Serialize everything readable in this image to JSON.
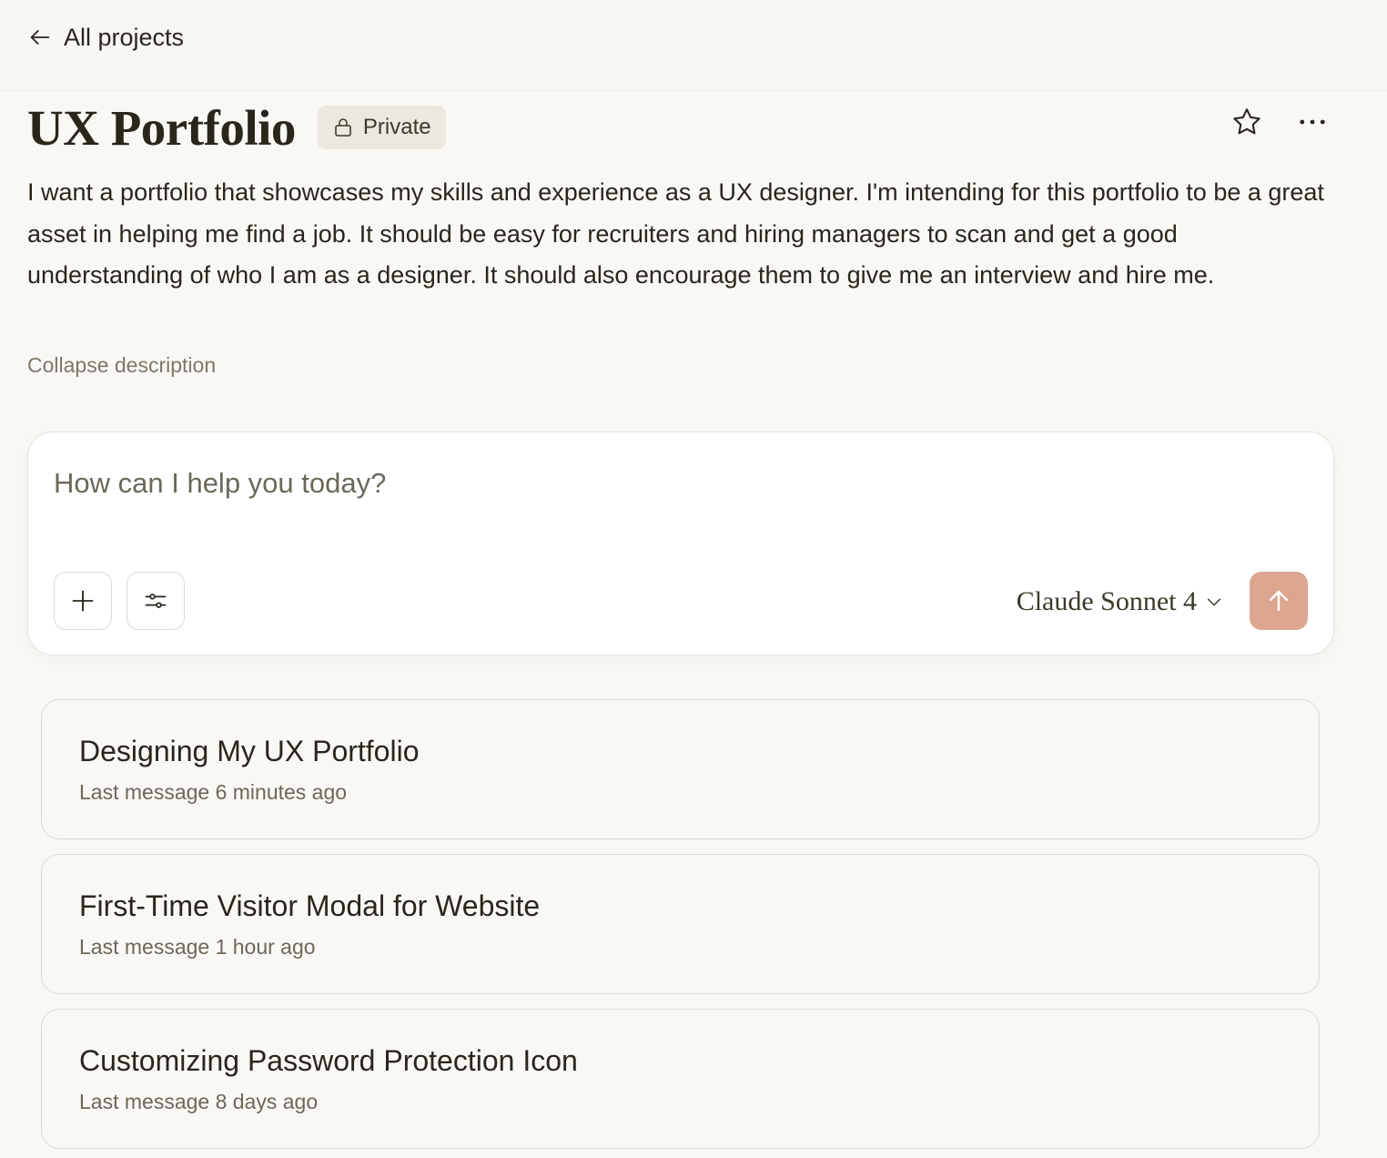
{
  "nav": {
    "back_label": "All projects",
    "back_icon": "arrow-left-icon"
  },
  "project": {
    "title": "UX Portfolio",
    "visibility": "Private",
    "visibility_icon": "lock-icon",
    "description": "I want a portfolio that showcases my skills and experience as a UX designer. I'm intending for this portfolio to be a great asset in helping me find a job. It should be easy for recruiters and hiring managers to scan and get a good understanding of who I am as a designer. It should also encourage them to give me an interview and hire me.",
    "collapse_label": "Collapse description",
    "actions": [
      "star-icon",
      "more-horizontal-icon"
    ]
  },
  "composer": {
    "placeholder": "How can I help you today?",
    "value": "",
    "model": "Claude Sonnet 4",
    "send_color": "#dca590",
    "tools": [
      "plus-icon",
      "sliders-icon"
    ]
  },
  "chats": [
    {
      "title": "Designing My UX Portfolio",
      "meta": "Last message 6 minutes ago"
    },
    {
      "title": "First-Time Visitor Modal for Website",
      "meta": "Last message 1 hour ago"
    },
    {
      "title": "Customizing Password Protection Icon",
      "meta": "Last message 8 days ago"
    }
  ],
  "colors": {
    "background": "#f9f8f4",
    "text": "#29261b",
    "muted": "#7b7869",
    "badge_bg": "#ebe8df"
  }
}
